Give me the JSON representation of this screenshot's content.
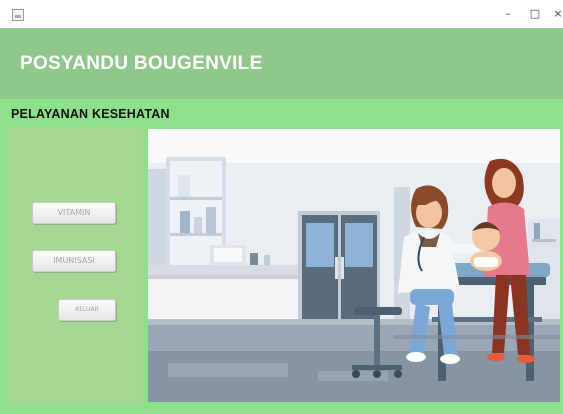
{
  "window": {
    "minimize_glyph": "–",
    "maximize_glyph": "□",
    "close_glyph": "×",
    "app_icon": "java-window-icon"
  },
  "header": {
    "title": "POSYANDU BOUGENVILE"
  },
  "section": {
    "title": "PELAYANAN KESEHATAN"
  },
  "menu": {
    "vitamin_label": "VITAMIN",
    "imunisasi_label": "IMUNISASI",
    "keluar_label": "KELUAR"
  },
  "illustration": {
    "subject": "clinic-scene-doctor-mother-baby"
  },
  "colors": {
    "window_bg": "#8fe08a",
    "header_bg": "#8fc88a",
    "panel_bg": "#a4d794",
    "header_text": "#ffffff"
  }
}
